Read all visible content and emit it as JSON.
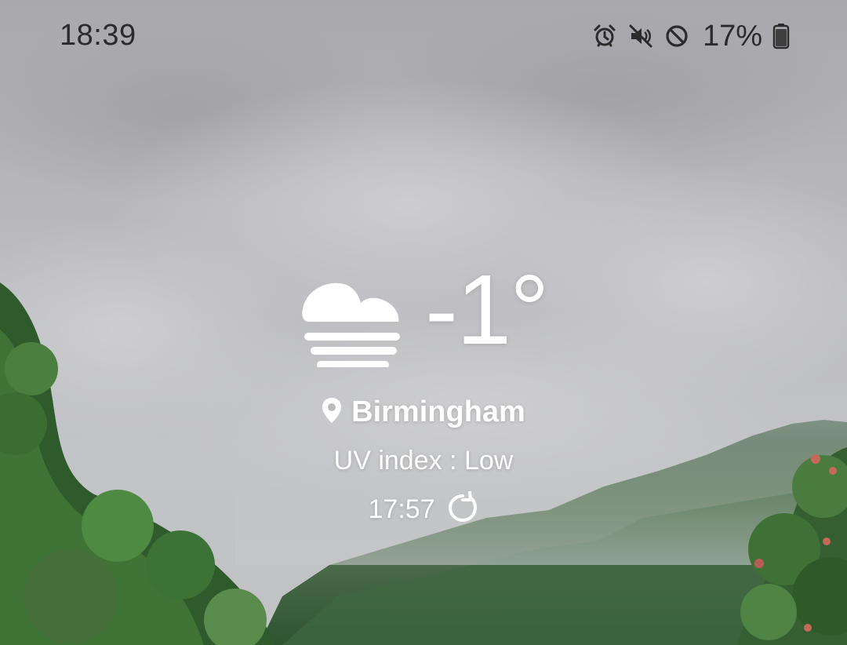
{
  "status_bar": {
    "time": "18:39",
    "battery_percent": "17%",
    "icons": [
      "alarm-icon",
      "mute-icon",
      "do-not-disturb-icon",
      "battery-icon"
    ],
    "text_color": "#2b2b2b"
  },
  "weather": {
    "condition_icon": "fog-icon",
    "temperature": "-1°",
    "location": "Birmingham",
    "uv_index": "UV index : Low",
    "updated_time": "17:57",
    "refresh_icon": "refresh-icon",
    "text_color": "#ffffff"
  }
}
